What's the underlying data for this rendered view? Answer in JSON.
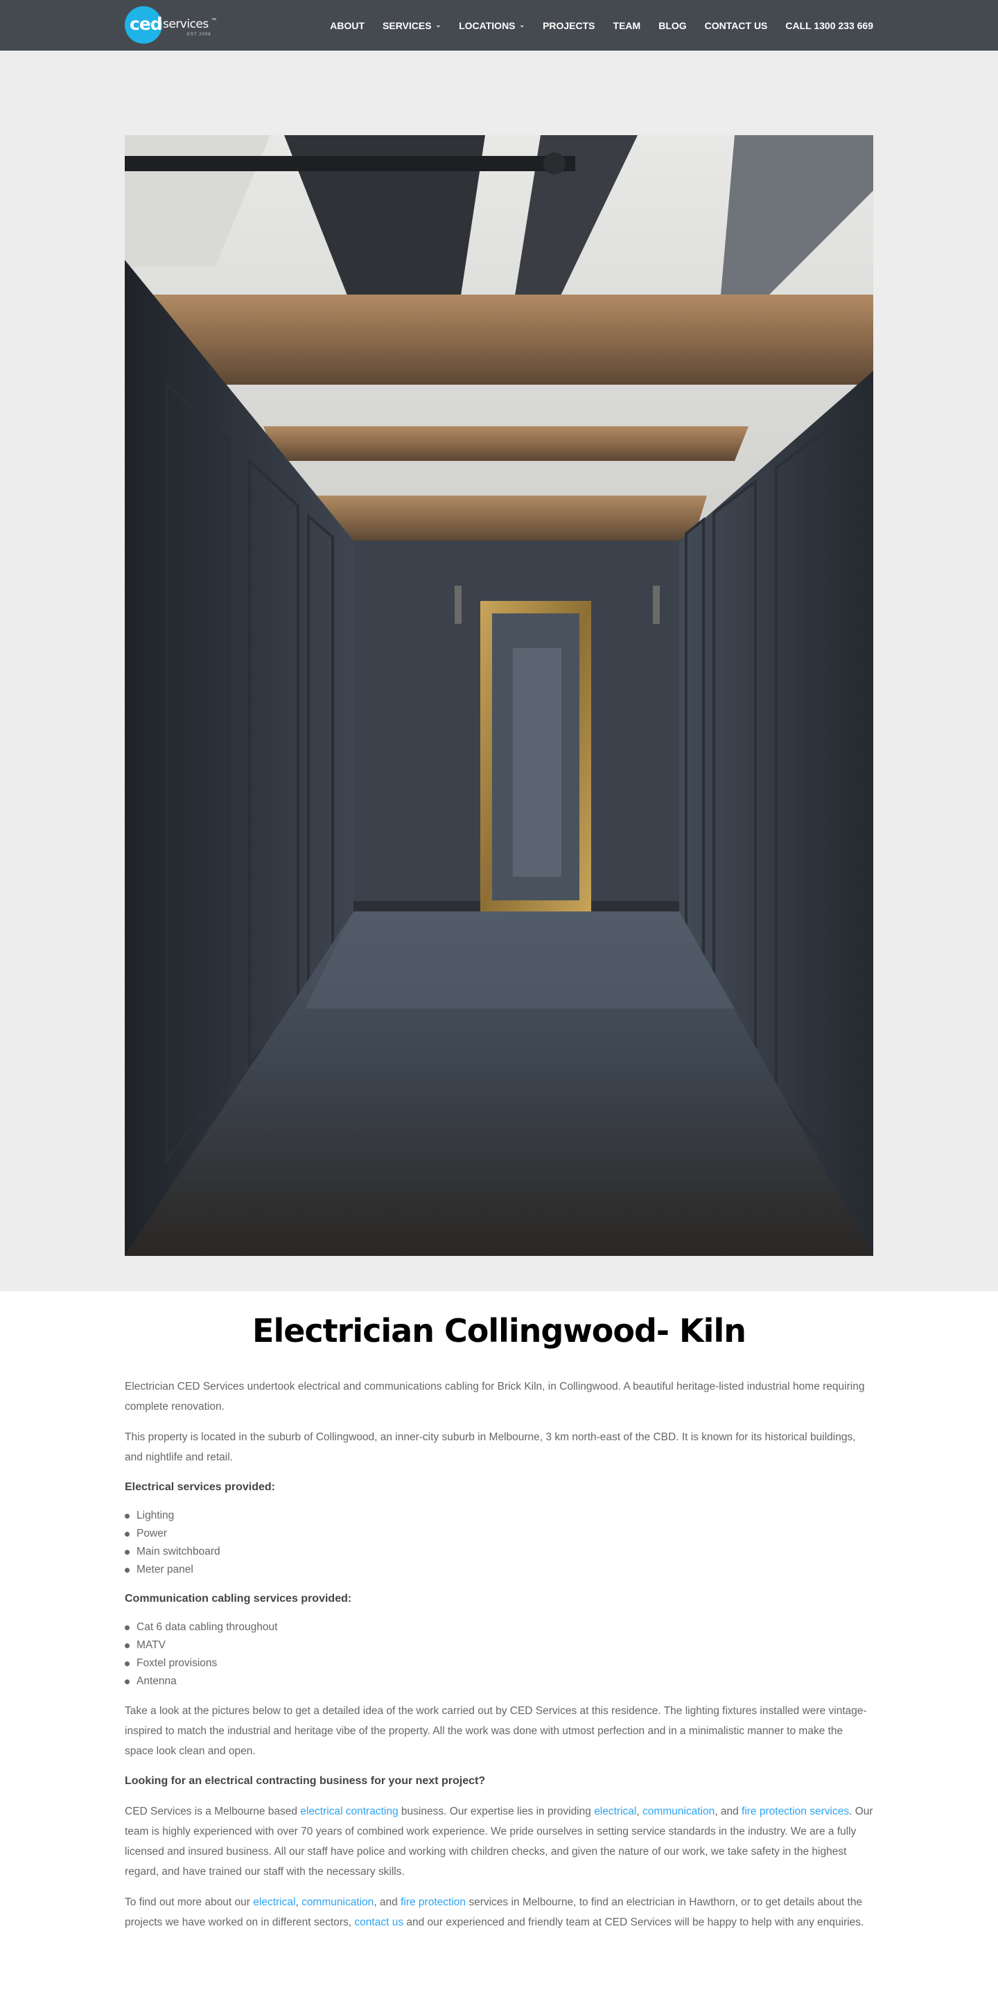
{
  "header": {
    "logo": {
      "ced": "ced",
      "services": "services",
      "tm": "™",
      "sub": "EST 2006"
    },
    "nav": [
      {
        "label": "ABOUT",
        "dropdown": false
      },
      {
        "label": "SERVICES",
        "dropdown": true
      },
      {
        "label": "LOCATIONS",
        "dropdown": true
      },
      {
        "label": "PROJECTS",
        "dropdown": false
      },
      {
        "label": "TEAM",
        "dropdown": false
      },
      {
        "label": "BLOG",
        "dropdown": false
      },
      {
        "label": "CONTACT US",
        "dropdown": false
      },
      {
        "label": "CALL 1300 233 669",
        "dropdown": false
      }
    ],
    "chevron": "⌄"
  },
  "colors": {
    "header_bg": "#454a50",
    "accent": "#1fb3e8",
    "link": "#2ea3f2",
    "hero_bg": "#ededed"
  },
  "main": {
    "title": "Electrician Collingwood- Kiln",
    "intro": "Electrician CED Services undertook electrical and communications cabling for Brick Kiln, in Collingwood. A beautiful heritage-listed industrial home requiring complete renovation.",
    "location": "This property is located in the suburb of Collingwood, an inner-city suburb in Melbourne, 3 km north-east of the CBD. It is known for its historical buildings, and nightlife and retail.",
    "electrical_heading": "Electrical services provided:",
    "electrical_items": [
      "Lighting",
      "Power",
      "Main switchboard",
      "Meter panel"
    ],
    "comms_heading": "Communication cabling services provided:",
    "comms_items": [
      "Cat 6 data cabling throughout",
      "MATV",
      "Foxtel provisions",
      "Antenna"
    ],
    "details": "Take a look at the pictures below to get a detailed idea of the work carried out by CED Services at this residence. The lighting fixtures installed were vintage-inspired to match the industrial and heritage vibe of the property. All the work was done with utmost perfection and in a minimalistic manner to make the space look clean and open.",
    "cta_heading": "Looking for an electrical contracting business for your next project?",
    "about": {
      "t1": "CED Services is a Melbourne based ",
      "l1": "electrical contracting",
      "t2": " business. Our expertise lies in providing ",
      "l2": "electrical",
      "t3": ", ",
      "l3": "communication",
      "t4": ", and ",
      "l4": "fire protection services",
      "t5": ". Our team is highly experienced with over 70 years of combined work experience. We pride ourselves in setting service standards in the industry. We are a fully licensed and insured business. All our staff have police and working with children checks, and given the nature of our work, we take safety in the highest regard, and have trained our staff with the necessary skills."
    },
    "contact": {
      "t1": "To find out more about our ",
      "l1": "electrical",
      "t2": ", ",
      "l2": "communication",
      "t3": ", and ",
      "l3": "fire protection",
      "t4": " services in Melbourne, to find an electrician in Hawthorn, or to get details about the projects we have worked on in different sectors, ",
      "l4": "contact us",
      "t5": " and our experienced and friendly team at CED Services will be happy to help with any enquiries."
    }
  }
}
